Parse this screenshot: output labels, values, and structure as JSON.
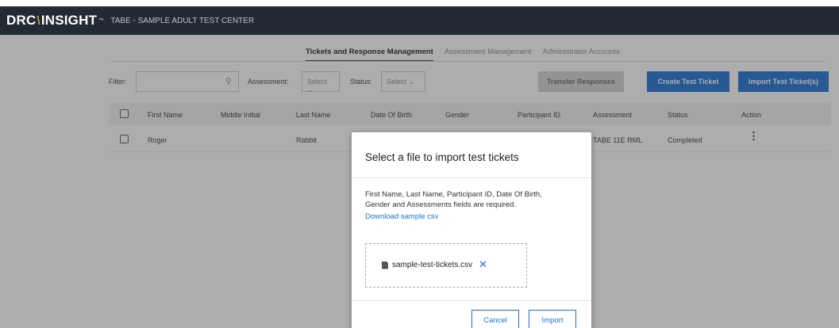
{
  "header": {
    "logo_drc": "DRC",
    "logo_insight": "INSIGHT",
    "logo_tm": "™",
    "org_name": "TABE - SAMPLE ADULT TEST CENTER"
  },
  "tabs": [
    {
      "label": "Tickets and Response Management",
      "active": true
    },
    {
      "label": "Assessment Management",
      "active": false
    },
    {
      "label": "Administrator Accounts",
      "active": false
    }
  ],
  "filters": {
    "filter_label": "Filter:",
    "filter_value": "",
    "assessment_label": "Assessment:",
    "assessment_value": "Select",
    "status_label": "Status:",
    "status_value": "Select"
  },
  "actions": {
    "transfer": "Transfer Responses",
    "create": "Create Test Ticket",
    "import": "Import Test Ticket(s)"
  },
  "table": {
    "columns": [
      "First Name",
      "Middle Initial",
      "Last Name",
      "Date Of Birth",
      "Gender",
      "Participant ID",
      "Assessment",
      "Status",
      "Action"
    ],
    "rows": [
      {
        "first": "Roger",
        "middle": "",
        "last": "Rabbit",
        "dob": "",
        "gender": "",
        "pid": "",
        "assessment": "TABE 11E RML",
        "status": "Completed"
      }
    ]
  },
  "modal": {
    "title": "Select a file to import test tickets",
    "description": "First Name, Last Name, Participant ID, Date Of Birth, Gender and Assessments fields are required.",
    "sample_link": "Download sample csv",
    "file_name": "sample-test-tickets.csv",
    "cancel": "Cancel",
    "import": "Import"
  },
  "colors": {
    "topbar": "#232a35",
    "accent": "#1a6fd6",
    "logo_slash": "#c9a227"
  }
}
